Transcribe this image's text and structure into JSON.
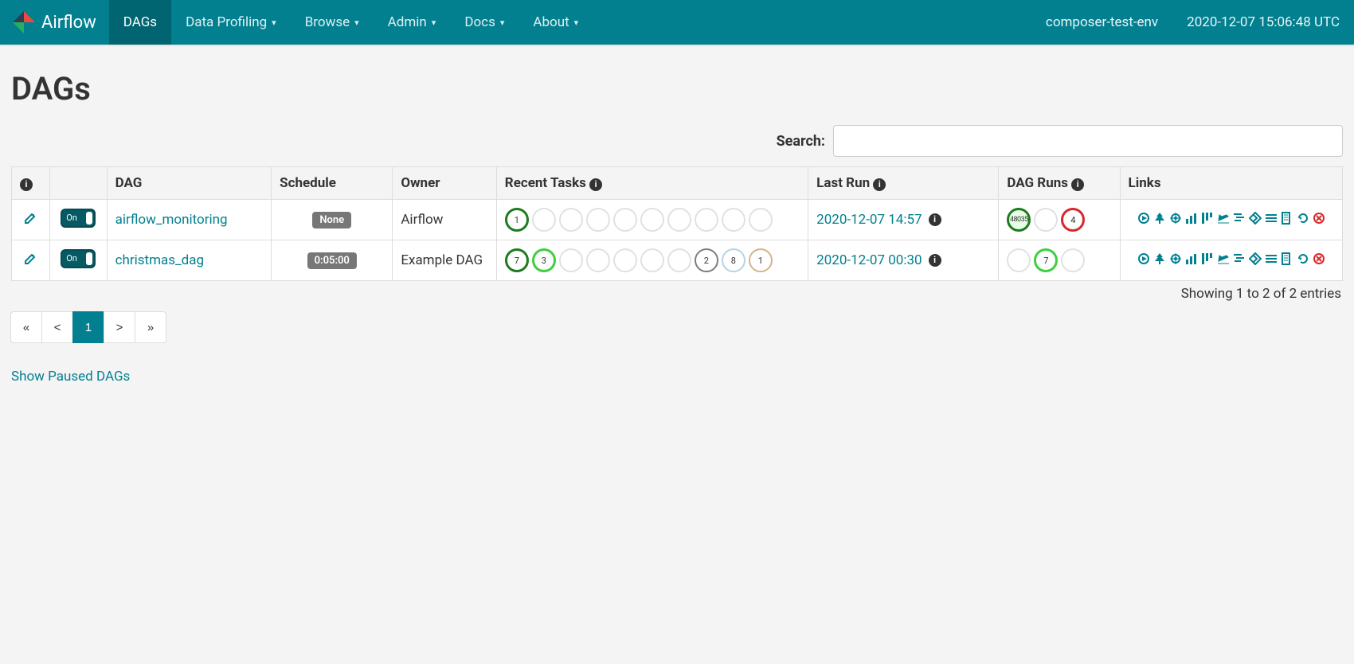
{
  "brand": {
    "name": "Airflow"
  },
  "nav": {
    "items": [
      {
        "label": "DAGs",
        "dropdown": false,
        "active": true
      },
      {
        "label": "Data Profiling",
        "dropdown": true,
        "active": false
      },
      {
        "label": "Browse",
        "dropdown": true,
        "active": false
      },
      {
        "label": "Admin",
        "dropdown": true,
        "active": false
      },
      {
        "label": "Docs",
        "dropdown": true,
        "active": false
      },
      {
        "label": "About",
        "dropdown": true,
        "active": false
      }
    ],
    "env": "composer-test-env",
    "clock": "2020-12-07 15:06:48 UTC"
  },
  "page": {
    "title": "DAGs",
    "search_label": "Search:",
    "search_value": ""
  },
  "table": {
    "headers": {
      "info": "ℹ",
      "toggle": "",
      "dag": "DAG",
      "schedule": "Schedule",
      "owner": "Owner",
      "recent_tasks": "Recent Tasks",
      "last_run": "Last Run",
      "dag_runs": "DAG Runs",
      "links": "Links"
    },
    "rows": [
      {
        "on": true,
        "dag": "airflow_monitoring",
        "schedule": "None",
        "owner": "Airflow",
        "recent_tasks": [
          {
            "count": "1",
            "style": "dgreen"
          },
          {
            "count": "",
            "style": "empty"
          },
          {
            "count": "",
            "style": "empty"
          },
          {
            "count": "",
            "style": "empty"
          },
          {
            "count": "",
            "style": "empty"
          },
          {
            "count": "",
            "style": "empty"
          },
          {
            "count": "",
            "style": "empty"
          },
          {
            "count": "",
            "style": "empty"
          },
          {
            "count": "",
            "style": "empty"
          },
          {
            "count": "",
            "style": "empty"
          }
        ],
        "last_run": "2020-12-07 14:57",
        "dag_runs": [
          {
            "count": "48035",
            "style": "fillgrn"
          },
          {
            "count": "",
            "style": "empty"
          },
          {
            "count": "4",
            "style": "red"
          }
        ]
      },
      {
        "on": true,
        "dag": "christmas_dag",
        "schedule": "0:05:00",
        "owner": "Example DAG",
        "recent_tasks": [
          {
            "count": "7",
            "style": "dgreen"
          },
          {
            "count": "3",
            "style": "lgreen"
          },
          {
            "count": "",
            "style": "empty"
          },
          {
            "count": "",
            "style": "empty"
          },
          {
            "count": "",
            "style": "empty"
          },
          {
            "count": "",
            "style": "empty"
          },
          {
            "count": "",
            "style": "empty"
          },
          {
            "count": "2",
            "style": "grey"
          },
          {
            "count": "8",
            "style": "lblue"
          },
          {
            "count": "1",
            "style": "tan"
          }
        ],
        "last_run": "2020-12-07 00:30",
        "dag_runs": [
          {
            "count": "",
            "style": "empty"
          },
          {
            "count": "7",
            "style": "lgreen"
          },
          {
            "count": "",
            "style": "empty"
          }
        ]
      }
    ]
  },
  "footer": {
    "entries_text": "Showing 1 to 2 of 2 entries",
    "pagination": {
      "first": "«",
      "prev": "<",
      "current": "1",
      "next": ">",
      "last": "»"
    },
    "show_paused": "Show Paused DAGs"
  },
  "link_icons": [
    "trigger-icon",
    "tree-icon",
    "graph-icon",
    "duration-icon",
    "tries-icon",
    "landing-icon",
    "gantt-icon",
    "details-icon",
    "code-icon",
    "logs-icon",
    "refresh-icon",
    "delete-icon"
  ],
  "colors": {
    "brand_bg": "#028090",
    "brand_bg_active": "#006471",
    "accent": "#028090",
    "danger": "#d9272b"
  }
}
